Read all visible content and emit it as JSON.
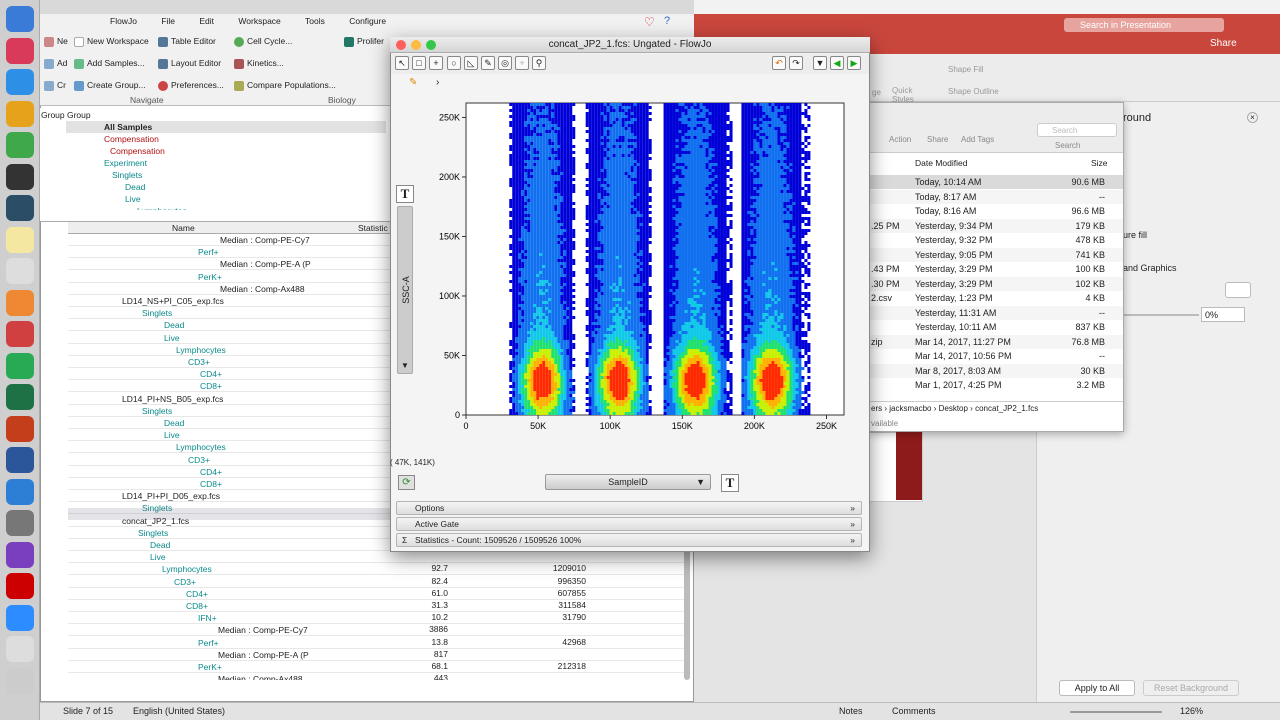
{
  "menu": {
    "app": "FlowJo",
    "items": [
      "File",
      "Edit",
      "Workspace",
      "Tools",
      "Configure"
    ]
  },
  "ribbon": {
    "col1": [
      "Ne",
      "Ad",
      "Cr"
    ],
    "col2": [
      "New Workspace",
      "Add Samples...",
      "Create Group..."
    ],
    "col3": [
      "Table Editor",
      "Layout Editor",
      "Preferences..."
    ],
    "col4": [
      "Cell Cycle...",
      "Kinetics...",
      "Compare Populations..."
    ],
    "col5": "Prolifer",
    "section_navigate": "Navigate",
    "section_biology": "Biology"
  },
  "group": {
    "header": "Group Group",
    "all": "All Samples",
    "comp1": "Compensation",
    "comp2": "Compensation",
    "exp": "Experiment",
    "singlets": "Singlets",
    "dead": "Dead",
    "live": "Live",
    "lymph": "Lymphocytes"
  },
  "table": {
    "col_name": "Name",
    "col_stat": "Statistic"
  },
  "rows": [
    [
      "Median : Comp-PE-Cy7",
      "",
      ""
    ],
    [
      "Perf+",
      "",
      ""
    ],
    [
      "Median : Comp-PE-A (P",
      "",
      ""
    ],
    [
      "PerK+",
      "",
      ""
    ],
    [
      "Median : Comp-Ax488",
      "",
      ""
    ],
    [
      "LD14_NS+PI_C05_exp.fcs",
      "",
      ""
    ],
    [
      "Singlets",
      "",
      ""
    ],
    [
      "Dead",
      "",
      ""
    ],
    [
      "Live",
      "",
      ""
    ],
    [
      "Lymphocytes",
      "",
      ""
    ],
    [
      "CD3+",
      "",
      ""
    ],
    [
      "CD4+",
      "",
      ""
    ],
    [
      "CD8+",
      "",
      ""
    ],
    [
      "LD14_PI+NS_B05_exp.fcs",
      "",
      ""
    ],
    [
      "Singlets",
      "",
      ""
    ],
    [
      "Dead",
      "",
      ""
    ],
    [
      "Live",
      "",
      ""
    ],
    [
      "Lymphocytes",
      "",
      ""
    ],
    [
      "CD3+",
      "",
      ""
    ],
    [
      "CD4+",
      "",
      ""
    ],
    [
      "CD8+",
      "",
      ""
    ],
    [
      "LD14_PI+PI_D05_exp.fcs",
      "",
      ""
    ],
    [
      "Singlets",
      "",
      ""
    ],
    [
      "concat_JP2_1.fcs",
      "",
      ""
    ],
    [
      "Singlets",
      "",
      ""
    ],
    [
      "Dead",
      "",
      ""
    ],
    [
      "Live",
      "",
      ""
    ],
    [
      "Lymphocytes",
      "92.7",
      "1209010"
    ],
    [
      "CD3+",
      "82.4",
      "996350"
    ],
    [
      "CD4+",
      "61.0",
      "607855"
    ],
    [
      "CD8+",
      "31.3",
      "311584"
    ],
    [
      "IFN+",
      "10.2",
      "31790"
    ],
    [
      "Median : Comp-PE-Cy7",
      "3886",
      ""
    ],
    [
      "Perf+",
      "13.8",
      "42968"
    ],
    [
      "Median : Comp-PE-A (P",
      "817",
      ""
    ],
    [
      "PerK+",
      "68.1",
      "212318"
    ],
    [
      "Median : Comp-Ax488",
      "443",
      ""
    ]
  ],
  "graph": {
    "title": "concat_JP2_1.fcs: Ungated - FlowJo",
    "ylabel": "SSC-A",
    "xaxis_select": "SampleID",
    "coords": "( 47K, 141K)",
    "options": "Options",
    "active_gate": "Active Gate",
    "statistics": "Statistics - Count: 1509526 / 1509526     100%"
  },
  "chart_data": {
    "type": "scatter",
    "xlabel": "SampleID",
    "ylabel": "SSC-A",
    "x_ticks": [
      "0",
      "50K",
      "100K",
      "150K",
      "200K",
      "250K"
    ],
    "y_ticks": [
      "0",
      "50K",
      "100K",
      "150K",
      "200K",
      "250K"
    ],
    "xlim": [
      0,
      262144
    ],
    "ylim": [
      0,
      262144
    ],
    "grid": false,
    "series": [
      {
        "x_range": [
          30000,
          74000
        ],
        "peak": [
          52000,
          30000
        ]
      },
      {
        "x_range": [
          83000,
          128000
        ],
        "peak": [
          105000,
          30000
        ]
      },
      {
        "x_range": [
          137000,
          183000
        ],
        "peak": [
          158000,
          30000
        ]
      },
      {
        "x_range": [
          191000,
          237000
        ],
        "peak": [
          211000,
          30000
        ]
      }
    ]
  },
  "finder": {
    "search": "Search",
    "actions": [
      "Action",
      "Share",
      "Add Tags"
    ],
    "search_label": "Search",
    "col_date": "Date Modified",
    "col_size": "Size",
    "files": [
      [
        "",
        "Today, 10:14 AM",
        "90.6 MB"
      ],
      [
        "",
        "Today, 8:17 AM",
        "--"
      ],
      [
        "",
        "Today, 8:16 AM",
        "96.6 MB"
      ],
      [
        ".25 PM",
        "Yesterday, 9:34 PM",
        "179 KB"
      ],
      [
        "",
        "Yesterday, 9:32 PM",
        "478 KB"
      ],
      [
        "",
        "Yesterday, 9:05 PM",
        "741 KB"
      ],
      [
        ".43 PM",
        "Yesterday, 3:29 PM",
        "100 KB"
      ],
      [
        ".30 PM",
        "Yesterday, 3:29 PM",
        "102 KB"
      ],
      [
        "2.csv",
        "Yesterday, 1:23 PM",
        "4 KB"
      ],
      [
        "",
        "Yesterday, 11:31 AM",
        "--"
      ],
      [
        "",
        "Yesterday, 10:11 AM",
        "837 KB"
      ],
      [
        "zip",
        "Mar 14, 2017, 11:27 PM",
        "76.8 MB"
      ],
      [
        "",
        "Mar 14, 2017, 10:56 PM",
        "--"
      ],
      [
        "",
        "Mar 8, 2017, 8:03 AM",
        "30 KB"
      ],
      [
        "",
        "Mar 1, 2017, 4:25 PM",
        "3.2 MB"
      ]
    ],
    "path": [
      "ers",
      "jacksmacbo",
      "Desktop",
      "concat_JP2_1.fcs"
    ],
    "avail": "vailable"
  },
  "ppt": {
    "search": "Search in Presentation",
    "share": "Share",
    "shape_fill": "Shape Fill",
    "shape_outline": "Shape Outline",
    "quick": "Quick Styles",
    "ge": "ge",
    "pane_title": "round",
    "fill": "ure fill",
    "graphics": "and Graphics",
    "pct": "0%",
    "apply_all": "Apply to All",
    "reset_bg": "Reset Background"
  },
  "status": {
    "slide": "Slide 7 of 15",
    "lang": "English (United States)",
    "notes": "Notes",
    "comments": "Comments",
    "zoom": "126%"
  }
}
